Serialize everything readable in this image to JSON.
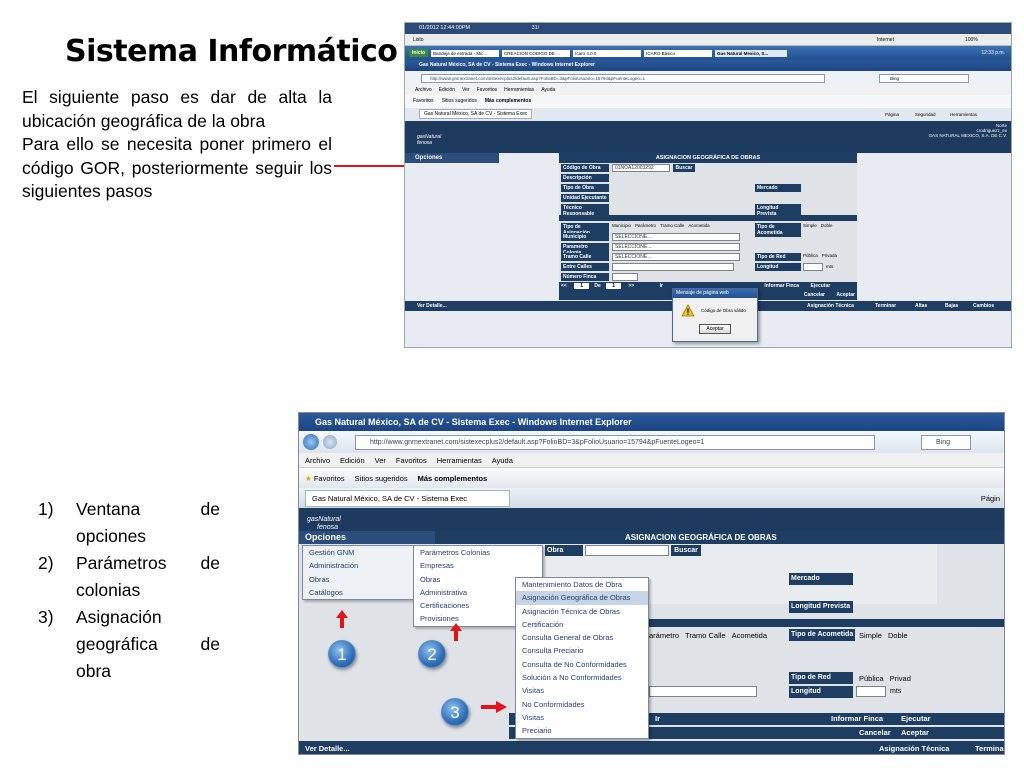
{
  "slide": {
    "title": "Sistema Informático",
    "intro_1": "El siguiente paso es dar de alta la ubicación geográfica de la obra",
    "intro_2": "Para ello se necesita poner primero el código GOR, posteriormente seguir los siguientes pasos",
    "steps": [
      {
        "num": "1)",
        "line1": "Ventana de",
        "line2": "opciones"
      },
      {
        "num": "2)",
        "line1": "Parámetros de",
        "line2": "colonias"
      },
      {
        "num": "3)",
        "line1": "Asignación",
        "line2": "geográfica de",
        "line3": "obra"
      }
    ],
    "accent_red": "#e3121b",
    "badge_blue": "#2f6eb8"
  },
  "top_shot": {
    "taskbar_time": "01/2012 12:44:00PM",
    "taskbar_num": "31/",
    "status_left": "Listo",
    "status_zone": "Internet",
    "zoom": "100%",
    "taskbar_items": [
      "Inicio",
      "Bandeja de entrada - Mic...",
      "CREACION CODIGO DE ...",
      "Icaro 4.0.0",
      "ICARO Básico",
      "Gas Natural Mexico, S..."
    ],
    "clock": "12:33 p.m.",
    "window_title": "Gas Natural México, SA de CV - Sistema Exec - Windows Internet Explorer",
    "url": "http://www.gnmextranet.com/sistexecplus2/default.asp?FolioBD=3&pFolioUsuario=15794&pFuenteLogeo=1",
    "search_engine": "Bing",
    "menus": [
      "Archivo",
      "Edición",
      "Ver",
      "Favoritos",
      "Herramientas",
      "Ayuda"
    ],
    "favorites": "Favoritos",
    "suggested": "Sitios sugeridos",
    "more": "Más complementos",
    "tab": "Gas Natural México, SA de CV - Sistema Exec",
    "cmd_items": [
      "Página",
      "Seguridad",
      "Herramientas"
    ],
    "user_region": "Norte",
    "user_name": "crodriguezz_ex",
    "company": "GAS NATURAL MEXICO, S.A. DE C.V.",
    "options": "Opciones",
    "form_title": "ASIGNACION GEOGRÁFICA DE OBRAS",
    "codigo_label": "Código de Obra",
    "codigo_value": "01NOA12003292",
    "buscar": "Buscar",
    "labels": [
      "Descripción",
      "Tipo de Obra",
      "Unidad Ejecutante",
      "Técnico Responsable"
    ],
    "mercado": "Mercado",
    "longitud_prevista": "Longitud Prevista",
    "tipo_asignacion": "Tipo de Asignación",
    "asignacion_options": [
      "Municipio",
      "Parámetro",
      "Tramo Calle",
      "Acometida"
    ],
    "tipo_acometida": "Tipo de Acometida",
    "acometida_options": [
      "Simple",
      "Doble"
    ],
    "municipio": "Municipio",
    "parametro_colonia": "Parametro Colonia",
    "tramo_calle": "Tramo Calle",
    "entre_calles": "Entre Calles",
    "numero_finca": "Número Finca",
    "select_placeholder": "SELECCIONE...",
    "tipo_red": "Tipo de Red",
    "red_options": [
      "Pública",
      "Privada"
    ],
    "longitud": "Longitud",
    "mts": "mts",
    "pager_prev": "<<",
    "pager_page": "1",
    "pager_de": "De",
    "pager_total": "1",
    "pager_next": ">>",
    "pager_go": "Ir",
    "informar_finca": "Informar Finca",
    "ejecutar": "Ejecutar",
    "cancelar": "Cancelar",
    "aceptar": "Aceptar",
    "ver_detalle": "Ver Detalle...",
    "bottom_buttons": [
      "Asignación Técnica",
      "Terminar",
      "Altas",
      "Bajas",
      "Cambios"
    ],
    "dialog_title": "Mensaje de página web",
    "dialog_message": "Código de Obra válido",
    "dialog_ok": "Aceptar"
  },
  "bottom_shot": {
    "window_title": "Gas Natural México, SA de CV - Sistema Exec - Windows Internet Explorer",
    "url": "http://www.gnmextranet.com/sistexecplus2/default.asp?FolioBD=3&pFolioUsuario=15794&pFuenteLogeo=1",
    "search_engine": "Bing",
    "menus": [
      "Archivo",
      "Edición",
      "Ver",
      "Favoritos",
      "Herramientas",
      "Ayuda"
    ],
    "favorites": "Favoritos",
    "suggested": "Sitios sugeridos",
    "more": "Más complementos",
    "tab": "Gas Natural México, SA de CV - Sistema Exec",
    "page_menu": "Págin",
    "logo_top": "gasNatural",
    "logo_bottom": "fenosa",
    "options": "Opciones",
    "form_title": "ASIGNACION GEOGRÁFICA DE OBRAS",
    "obra_label": "Obra",
    "buscar": "Buscar",
    "mercado": "Mercado",
    "longitud_prevista": "Longitud Prevista",
    "asignacion_partial": [
      "Parámetro",
      "Tramo Calle",
      "Acometida"
    ],
    "tipo_acometida": "Tipo de Acometida",
    "acometida_options": [
      "Simple",
      "Doble"
    ],
    "tipo_red": "Tipo de Red",
    "red_options": [
      "Pública",
      "Privad"
    ],
    "longitud": "Longitud",
    "mts": "mts",
    "pager_go": "Ir",
    "informar_finca": "Informar Finca",
    "ejecutar": "Ejecutar",
    "cancelar": "Cancelar",
    "aceptar": "Aceptar",
    "ver_detalle": "Ver Detalle...",
    "asignacion_tecnica": "Asignación Técnica",
    "terminar": "Terminar",
    "menu1": [
      "Gestión GNM",
      "Administración",
      "Obras",
      "Catálogos"
    ],
    "menu2": [
      "Parámetros Colonias",
      "Empresas",
      "Obras",
      "Administrativa",
      "Certificaciones",
      "Provisiones"
    ],
    "menu3": [
      "Mantenimiento Datos de Obra",
      "Asignación Geográfica de Obras",
      "Asignación Técnica de Obras",
      "Certificación",
      "Consulta General de Obras",
      "Consulta Preciario",
      "Consulta de No Conformidades",
      "Solución a No Conformidades",
      "Visitas",
      "No Conformidades",
      "Visitas",
      "Preciario"
    ],
    "badges": [
      "1",
      "2",
      "3"
    ]
  }
}
